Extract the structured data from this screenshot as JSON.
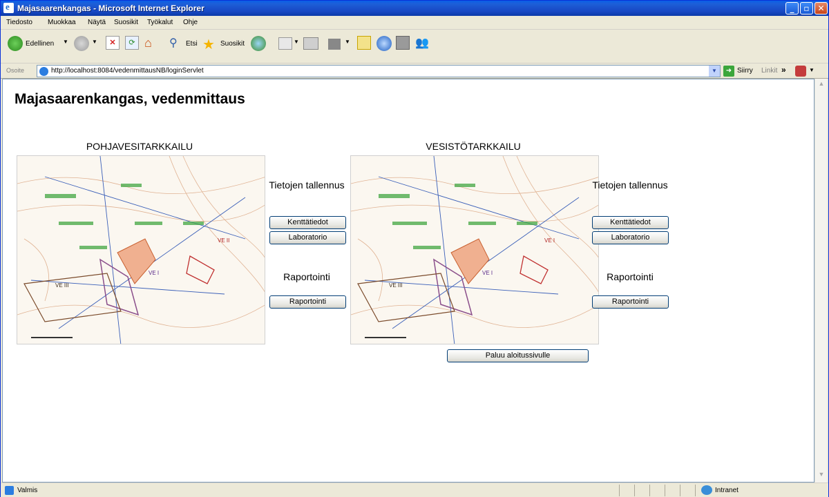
{
  "window": {
    "title": "Majasaarenkangas - Microsoft Internet Explorer"
  },
  "menu": [
    "Tiedosto",
    "Muokkaa",
    "Näytä",
    "Suosikit",
    "Työkalut",
    "Ohje"
  ],
  "toolbar": {
    "back_label": "Edellinen",
    "search_label": "Etsi",
    "favorites_label": "Suosikit"
  },
  "address": {
    "label": "Osoite",
    "url": "http://localhost:8084/vedenmittausNB/loginServlet",
    "go_label": "Siirry",
    "links_label": "Linkit"
  },
  "page": {
    "title": "Majasaarenkangas, vedenmittaus",
    "sections": [
      {
        "heading": "POHJAVESITARKKAILU",
        "store_label": "Tietojen tallennus",
        "field_button": "Kenttätiedot",
        "lab_button": "Laboratorio",
        "report_label": "Raportointi",
        "report_button": "Raportointi"
      },
      {
        "heading": "VESISTÖTARKKAILU",
        "store_label": "Tietojen tallennus",
        "field_button": "Kenttätiedot",
        "lab_button": "Laboratorio",
        "report_label": "Raportointi",
        "report_button": "Raportointi"
      }
    ],
    "map_labels": [
      "VE II",
      "VE I",
      "VE III"
    ],
    "return_button": "Paluu aloitussivulle"
  },
  "status": {
    "text": "Valmis",
    "zone": "Intranet"
  },
  "colors": {
    "titlebar": "#1848c4",
    "button_border": "#003c74"
  }
}
